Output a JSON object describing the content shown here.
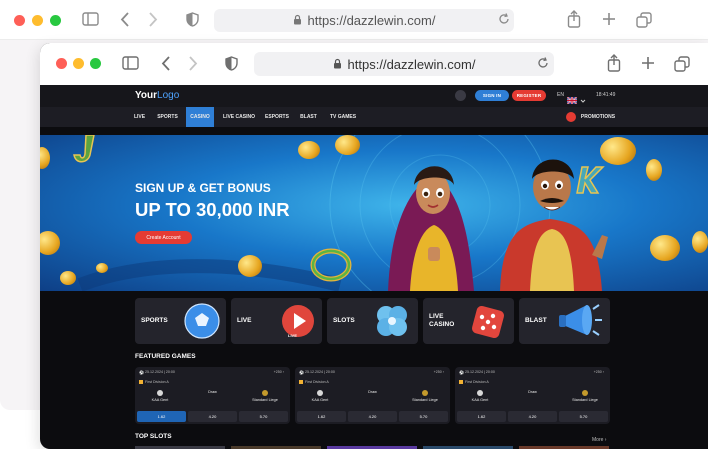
{
  "browser_back": {
    "url": "https://dazzlewin.com/"
  },
  "browser_front": {
    "url": "https://dazzlewin.com/"
  },
  "header": {
    "logo_your": "Your",
    "logo_logo": "Logo",
    "signin": "SIGN IN",
    "register": "REGISTER",
    "lang": "EN",
    "time": "18:41:49"
  },
  "nav": {
    "items": [
      "LIVE",
      "SPORTS",
      "CASINO",
      "LIVE CASINO",
      "ESPORTS",
      "BLAST",
      "TV GAMES"
    ],
    "active": "CASINO",
    "promotions": "PROMOTIONS"
  },
  "hero": {
    "subtitle": "SIGN UP & GET BONUS",
    "title": "UP TO 30,000 INR",
    "cta": "Create Account"
  },
  "categories": [
    {
      "label": "SPORTS",
      "icon": "soccer-ball-icon"
    },
    {
      "label": "LIVE",
      "icon": "live-play-icon",
      "badge": "LIVE"
    },
    {
      "label": "SLOTS",
      "icon": "clover-icon"
    },
    {
      "label": "LIVE CASINO",
      "label_line1": "LIVE",
      "label_line2": "CASINO",
      "icon": "dice-icon"
    },
    {
      "label": "BLAST",
      "icon": "megaphone-icon"
    }
  ],
  "featured": {
    "title": "FEATURED GAMES",
    "games": [
      {
        "date": "25.12.2024 | 20:00",
        "more": "+250 ›",
        "league": "First Division A",
        "home": "KAA Gent",
        "draw": "Draw",
        "away": "Standard Liege",
        "odds": [
          "1.62",
          "4.20",
          "5.70"
        ]
      },
      {
        "date": "25.12.2024 | 20:00",
        "more": "+250 ›",
        "league": "First Division A",
        "home": "KAA Gent",
        "draw": "Draw",
        "away": "Standard Liege",
        "odds": [
          "1.62",
          "4.20",
          "5.70"
        ]
      },
      {
        "date": "25.12.2024 | 20:00",
        "more": "+250 ›",
        "league": "First Division A",
        "home": "KAA Gent",
        "draw": "Draw",
        "away": "Standard Liege",
        "odds": [
          "1.62",
          "4.20",
          "5.70"
        ]
      }
    ]
  },
  "top_slots": {
    "title": "TOP SLOTS",
    "more": "More"
  },
  "colors": {
    "accent_blue": "#2f7fd6",
    "accent_red": "#e53b33",
    "bg_dark": "#0c0c0f"
  }
}
